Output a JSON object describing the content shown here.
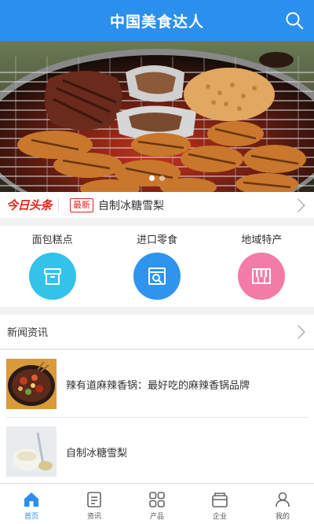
{
  "header": {
    "title": "中国美食达人",
    "search_icon": "search-icon"
  },
  "banner": {
    "image": "grilled-meat-on-barbecue-grill",
    "slide_count": 2,
    "active_slide": 1
  },
  "headline": {
    "logo": "今日头条",
    "badge": "最新",
    "text": "自制冰糖雪梨"
  },
  "categories": [
    {
      "label": "面包糕点",
      "icon": "box-icon",
      "color": "#33c3ea"
    },
    {
      "label": "进口零食",
      "icon": "search-box-icon",
      "color": "#2e94ee"
    },
    {
      "label": "地域特产",
      "icon": "piano-icon",
      "color": "#f37ca7"
    }
  ],
  "news": {
    "title": "新闻资讯",
    "items": [
      {
        "title": "辣有道麻辣香锅：最好吃的麻辣香锅品牌",
        "image": "spicy-hot-pot-dish"
      },
      {
        "title": "自制冰糖雪梨",
        "image": "rock-sugar-pear-drink"
      }
    ]
  },
  "tabbar": {
    "active": 0,
    "items": [
      {
        "label": "首页",
        "icon": "home-icon"
      },
      {
        "label": "资讯",
        "icon": "news-icon"
      },
      {
        "label": "产品",
        "icon": "grid-icon"
      },
      {
        "label": "企业",
        "icon": "company-icon"
      },
      {
        "label": "我的",
        "icon": "user-icon"
      }
    ]
  },
  "colors": {
    "primary": "#2b90ed",
    "headline_red": "#e2231a"
  }
}
